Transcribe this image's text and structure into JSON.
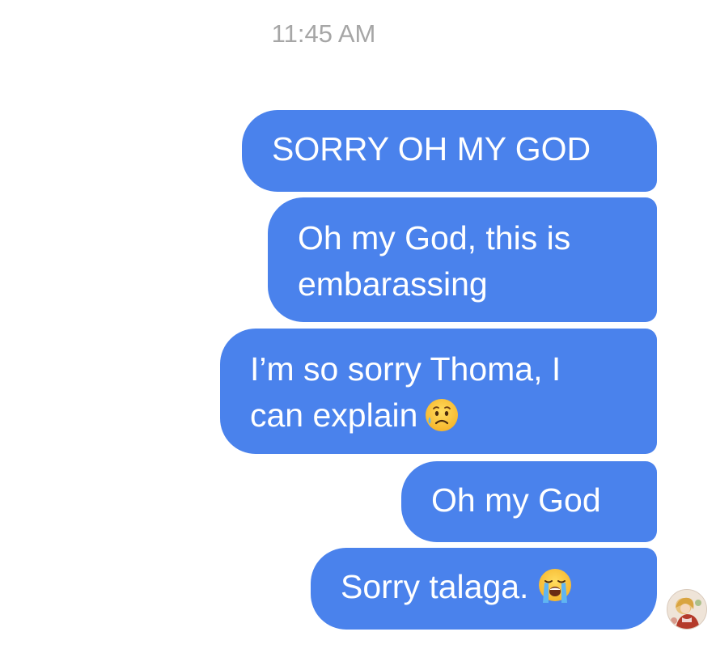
{
  "timestamp": "11:45 AM",
  "messages": [
    {
      "lines": [
        "SORRY OH MY GOD"
      ]
    },
    {
      "lines": [
        "Oh my God, this is",
        "embarassing"
      ]
    },
    {
      "lines": [
        "I’m so sorry Thoma, I",
        "can explain"
      ],
      "emoji": "sad-but-relieved-face-icon"
    },
    {
      "lines": [
        "Oh my God"
      ]
    },
    {
      "lines": [
        "Sorry talaga."
      ],
      "emoji": "loudly-crying-face-icon"
    }
  ],
  "colors": {
    "bubble": "#4a82ec",
    "bubble_text": "#ffffff",
    "timestamp": "#a6a6a6",
    "background": "#ffffff"
  }
}
